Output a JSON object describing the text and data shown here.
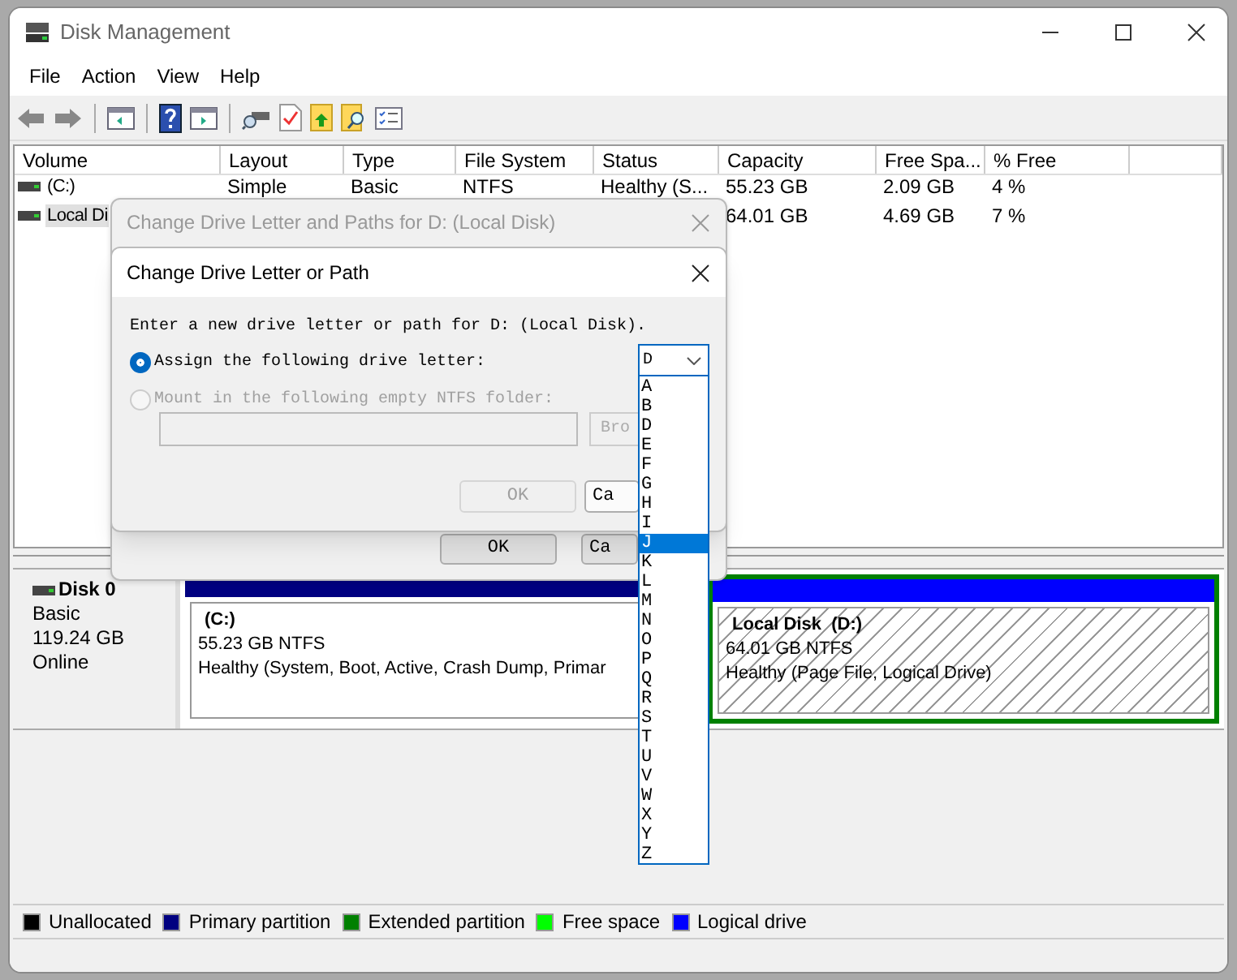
{
  "window": {
    "title": "Disk Management"
  },
  "menu": [
    "File",
    "Action",
    "View",
    "Help"
  ],
  "table": {
    "columns": [
      "Volume",
      "Layout",
      "Type",
      "File System",
      "Status",
      "Capacity",
      "Free Spa...",
      "% Free"
    ],
    "rows": [
      {
        "selected": false,
        "cells": [
          "(C:)",
          "Simple",
          "Basic",
          "NTFS",
          "Healthy (S...",
          "55.23 GB",
          "2.09 GB",
          "4 %"
        ]
      },
      {
        "selected": true,
        "cells": [
          "Local Di",
          null,
          null,
          null,
          null,
          "64.01 GB",
          "4.69 GB",
          "7 %"
        ]
      }
    ]
  },
  "disk": {
    "name": "Disk 0",
    "type": "Basic",
    "size": "119.24 GB",
    "status": "Online",
    "partitions": [
      {
        "kind": "primary",
        "selected": false,
        "name": "(C:)",
        "size": "55.23 GB NTFS",
        "status": "Healthy (System, Boot, Active, Crash Dump, Primar"
      },
      {
        "kind": "logical",
        "selected": true,
        "name": "Local Disk  (D:)",
        "size": "64.01 GB NTFS",
        "status": "Healthy (Page File, Logical Drive)"
      }
    ]
  },
  "legend": [
    {
      "label": "Unallocated",
      "color": "#000000"
    },
    {
      "label": "Primary partition",
      "color": "#000080"
    },
    {
      "label": "Extended partition",
      "color": "#008000"
    },
    {
      "label": "Free space",
      "color": "#00ff00"
    },
    {
      "label": "Logical drive",
      "color": "#0000ff"
    }
  ],
  "paths_dialog": {
    "title": "Change Drive Letter and Paths for D: (Local Disk)",
    "buttons": [
      "OK",
      "Ca"
    ]
  },
  "letter_dialog": {
    "title": "Change Drive Letter or Path",
    "prompt": "Enter a new drive letter or path for D: (Local Disk).",
    "options": [
      {
        "label": "Assign the following drive letter:",
        "selected": true,
        "disabled": false
      },
      {
        "label": "Mount in the following empty NTFS folder:",
        "selected": false,
        "disabled": true
      }
    ],
    "letter_value": "D",
    "browse_button": "Bro",
    "buttons": [
      {
        "label": "OK",
        "disabled": true
      },
      {
        "label": "Ca",
        "disabled": false
      }
    ]
  },
  "letter_list": [
    {
      "label": "A",
      "selected": false
    },
    {
      "label": "B",
      "selected": false
    },
    {
      "label": "D",
      "selected": false
    },
    {
      "label": "E",
      "selected": false
    },
    {
      "label": "F",
      "selected": false
    },
    {
      "label": "G",
      "selected": false
    },
    {
      "label": "H",
      "selected": false
    },
    {
      "label": "I",
      "selected": false
    },
    {
      "label": "J",
      "selected": true
    },
    {
      "label": "K",
      "selected": false
    },
    {
      "label": "L",
      "selected": false
    },
    {
      "label": "M",
      "selected": false
    },
    {
      "label": "N",
      "selected": false
    },
    {
      "label": "O",
      "selected": false
    },
    {
      "label": "P",
      "selected": false
    },
    {
      "label": "Q",
      "selected": false
    },
    {
      "label": "R",
      "selected": false
    },
    {
      "label": "S",
      "selected": false
    },
    {
      "label": "T",
      "selected": false
    },
    {
      "label": "U",
      "selected": false
    },
    {
      "label": "V",
      "selected": false
    },
    {
      "label": "W",
      "selected": false
    },
    {
      "label": "X",
      "selected": false
    },
    {
      "label": "Y",
      "selected": false
    },
    {
      "label": "Z",
      "selected": false
    }
  ]
}
